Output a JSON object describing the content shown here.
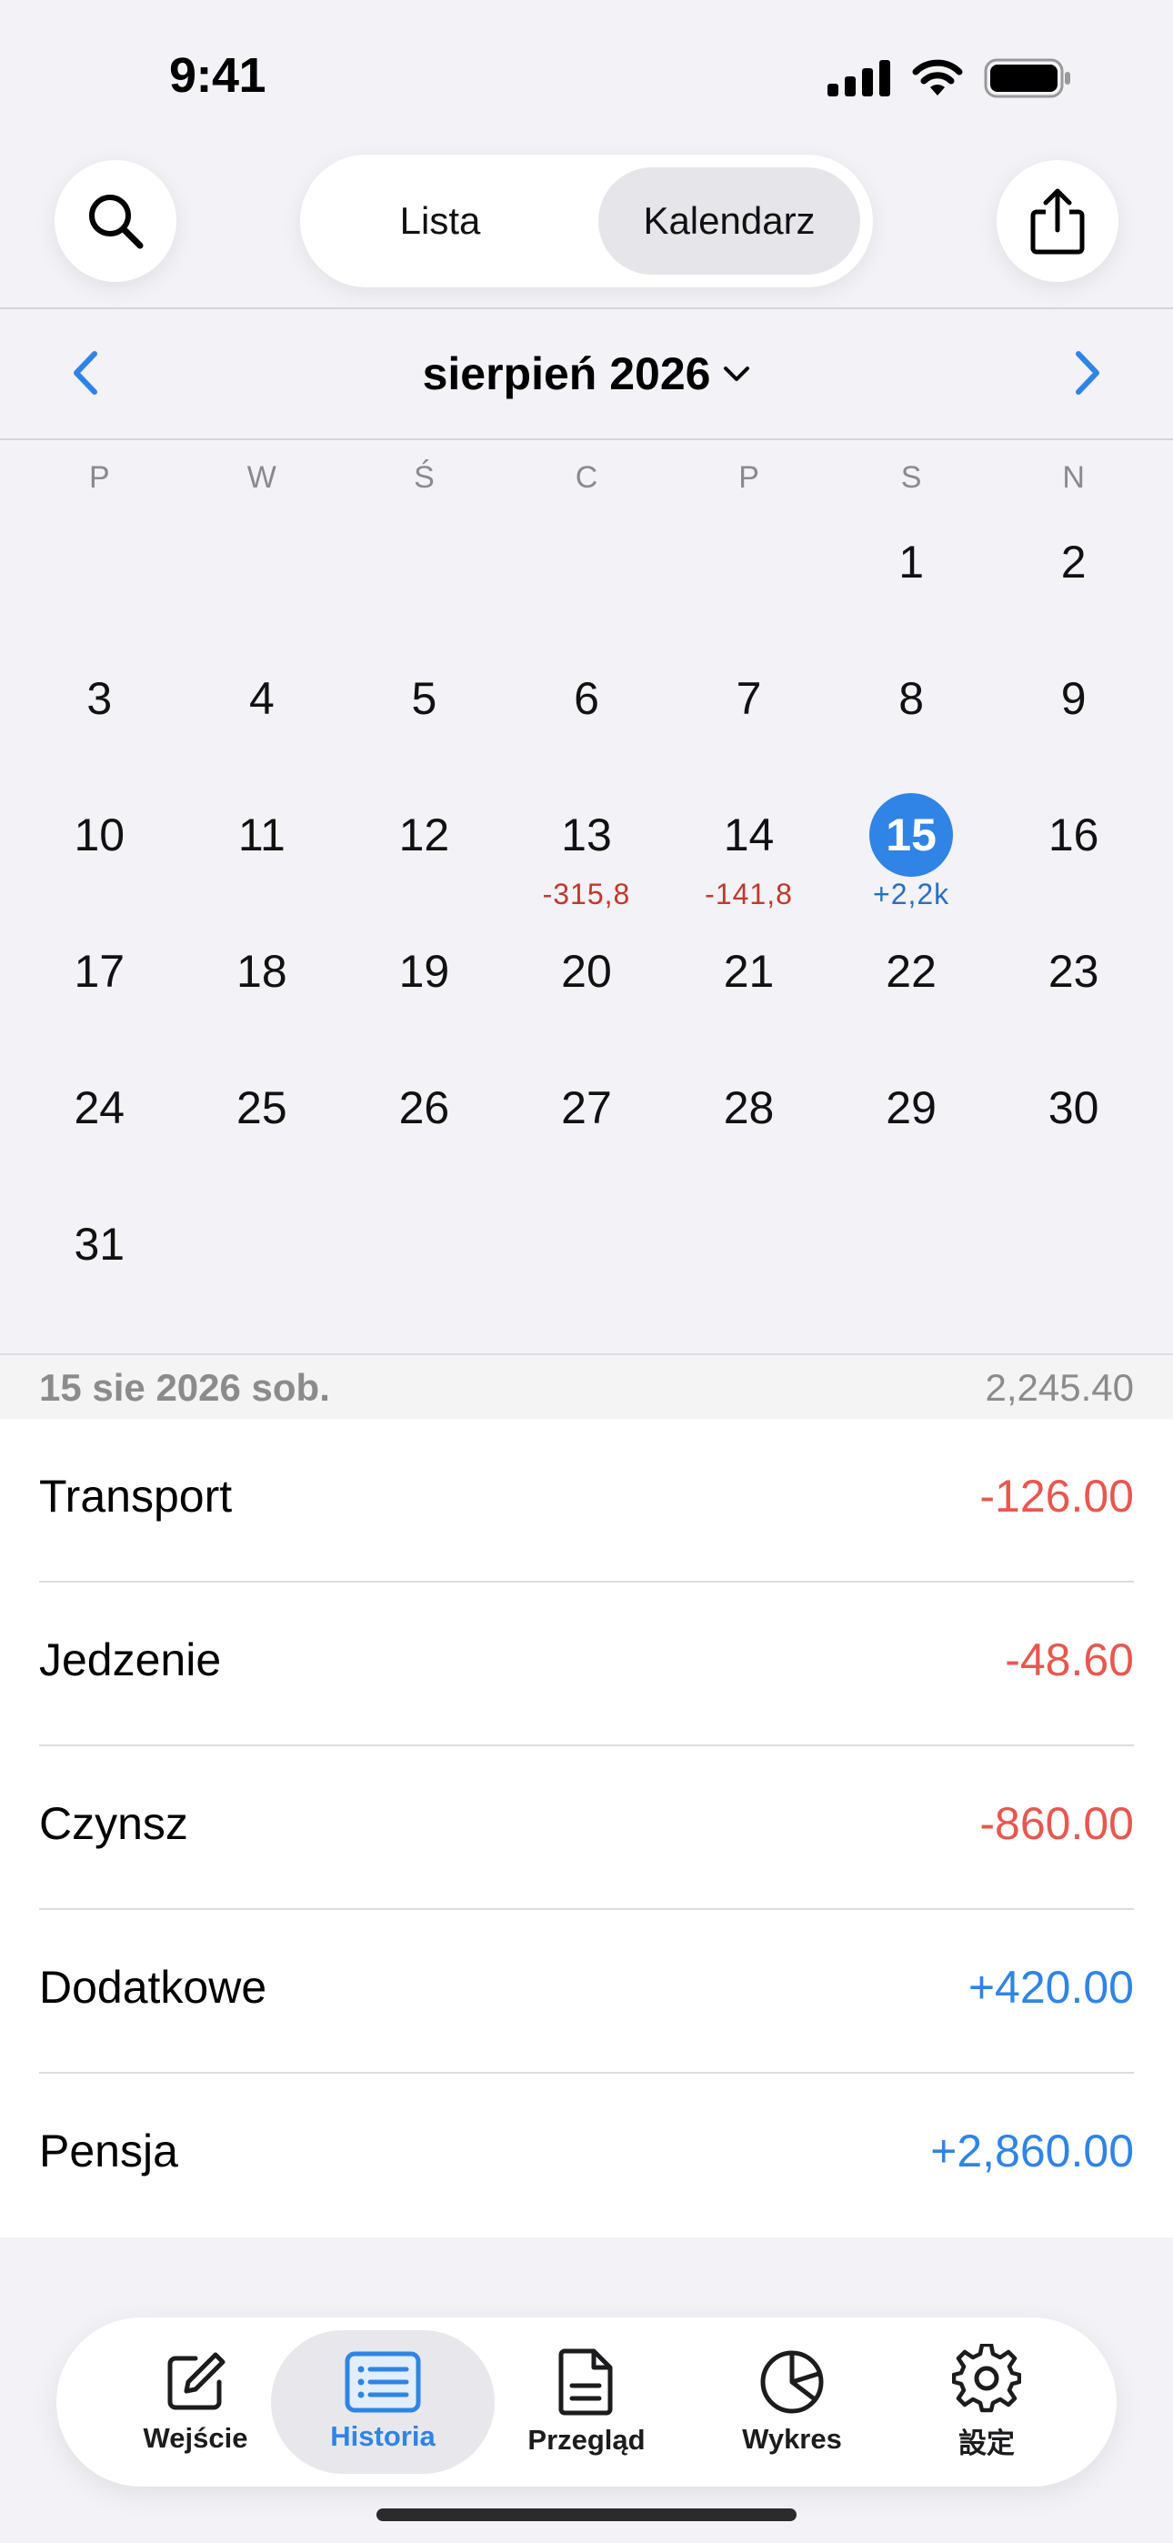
{
  "status_bar": {
    "time": "9:41"
  },
  "toolbar": {
    "segments": [
      "Lista",
      "Kalendarz"
    ],
    "selected_segment": "Kalendarz"
  },
  "month": {
    "title": "sierpień 2026"
  },
  "weekdays": [
    "P",
    "W",
    "Ś",
    "C",
    "P",
    "S",
    "N"
  ],
  "calendar": {
    "days": [
      "1",
      "2",
      "3",
      "4",
      "5",
      "6",
      "7",
      "8",
      "9",
      "10",
      "11",
      "12",
      "13",
      "14",
      "15",
      "16",
      "17",
      "18",
      "19",
      "20",
      "21",
      "22",
      "23",
      "24",
      "25",
      "26",
      "27",
      "28",
      "29",
      "30",
      "31"
    ],
    "leading_blanks": 5,
    "selected_day": "15",
    "day_amounts": {
      "13": "-315,8",
      "14": "-141,8",
      "15": "+2,2k"
    }
  },
  "day_summary": {
    "date": "15 sie 2026 sob.",
    "total": "2,245.40"
  },
  "entries": [
    {
      "category": "Transport",
      "amount": "-126.00",
      "sign": "neg"
    },
    {
      "category": "Jedzenie",
      "amount": "-48.60",
      "sign": "neg"
    },
    {
      "category": "Czynsz",
      "amount": "-860.00",
      "sign": "neg"
    },
    {
      "category": "Dodatkowe",
      "amount": "+420.00",
      "sign": "pos"
    },
    {
      "category": "Pensja",
      "amount": "+2,860.00",
      "sign": "pos"
    }
  ],
  "tabs": [
    {
      "label": "Wejście",
      "icon": "compose-icon"
    },
    {
      "label": "Historia",
      "icon": "list-icon",
      "active": true
    },
    {
      "label": "Przegląd",
      "icon": "document-icon"
    },
    {
      "label": "Wykres",
      "icon": "pie-chart-icon"
    },
    {
      "label": "設定",
      "icon": "gear-icon"
    }
  ],
  "colors": {
    "accent": "#2f84e6",
    "negative": "#e8574f",
    "positive": "#2f84e6"
  }
}
